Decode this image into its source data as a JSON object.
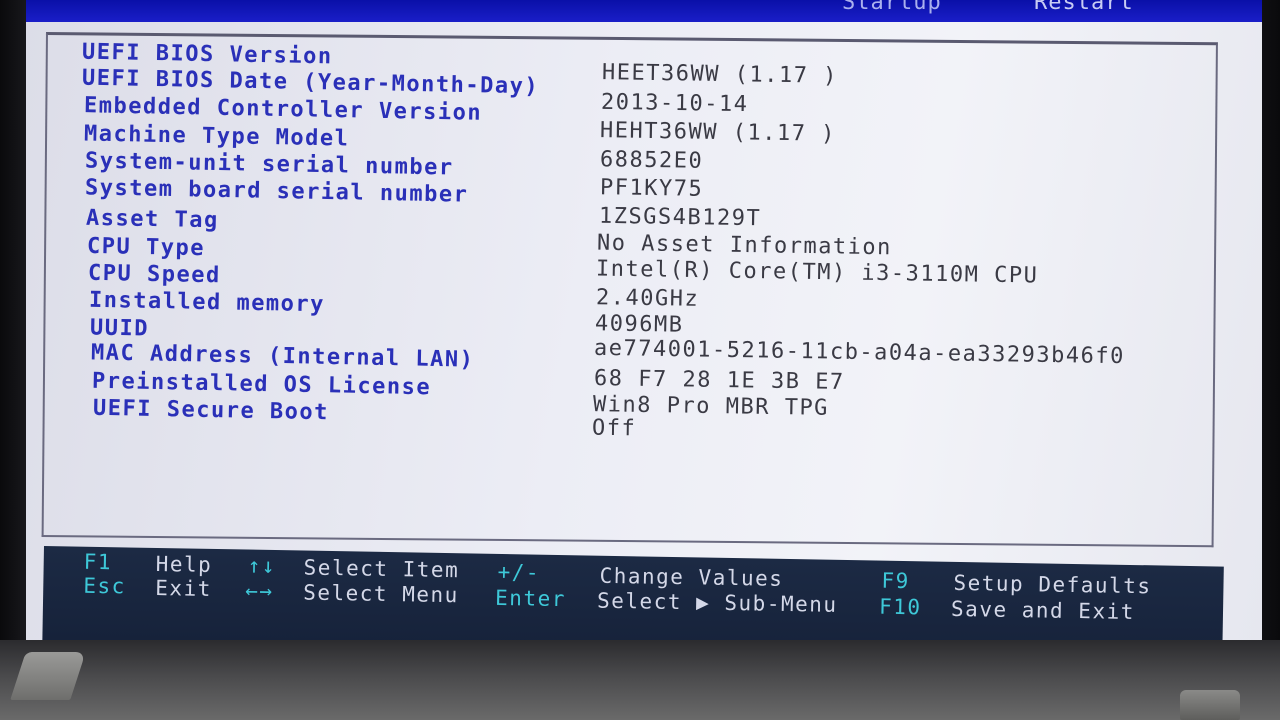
{
  "menu": {
    "tabs": [
      "Startup",
      "Restart"
    ]
  },
  "info": {
    "labels": [
      "UEFI BIOS Version",
      "UEFI BIOS Date (Year-Month-Day)",
      "Embedded Controller Version",
      "Machine Type Model",
      "System-unit serial number",
      "System board serial number",
      "Asset Tag",
      "CPU Type",
      "CPU Speed",
      "Installed memory",
      "UUID",
      "MAC Address (Internal LAN)",
      "Preinstalled OS License",
      "UEFI Secure Boot"
    ],
    "values": [
      "HEET36WW (1.17 )",
      "2013-10-14",
      "HEHT36WW (1.17 )",
      "68852E0",
      "PF1KY75",
      "1ZSGS4B129T",
      "No Asset Information",
      "Intel(R) Core(TM) i3-3110M CPU",
      "2.40GHz",
      "4096MB",
      "ae774001-5216-11cb-a04a-ea33293b46f0",
      "68 F7 28 1E 3B E7",
      "Win8 Pro MBR TPG",
      "Off"
    ]
  },
  "footer": {
    "f1_key": "F1",
    "f1_desc": "Help",
    "esc_key": "Esc",
    "esc_desc": "Exit",
    "updown_key": "↑↓",
    "updown_desc": "Select Item",
    "leftright_key": "←→",
    "leftright_desc": "Select Menu",
    "plusminus_key": "+/-",
    "plusminus_desc": "Change Values",
    "enter_key": "Enter",
    "enter_desc": "Select ▶ Sub-Menu",
    "f9_key": "F9",
    "f9_desc": "Setup Defaults",
    "f10_key": "F10",
    "f10_desc": "Save and Exit"
  }
}
